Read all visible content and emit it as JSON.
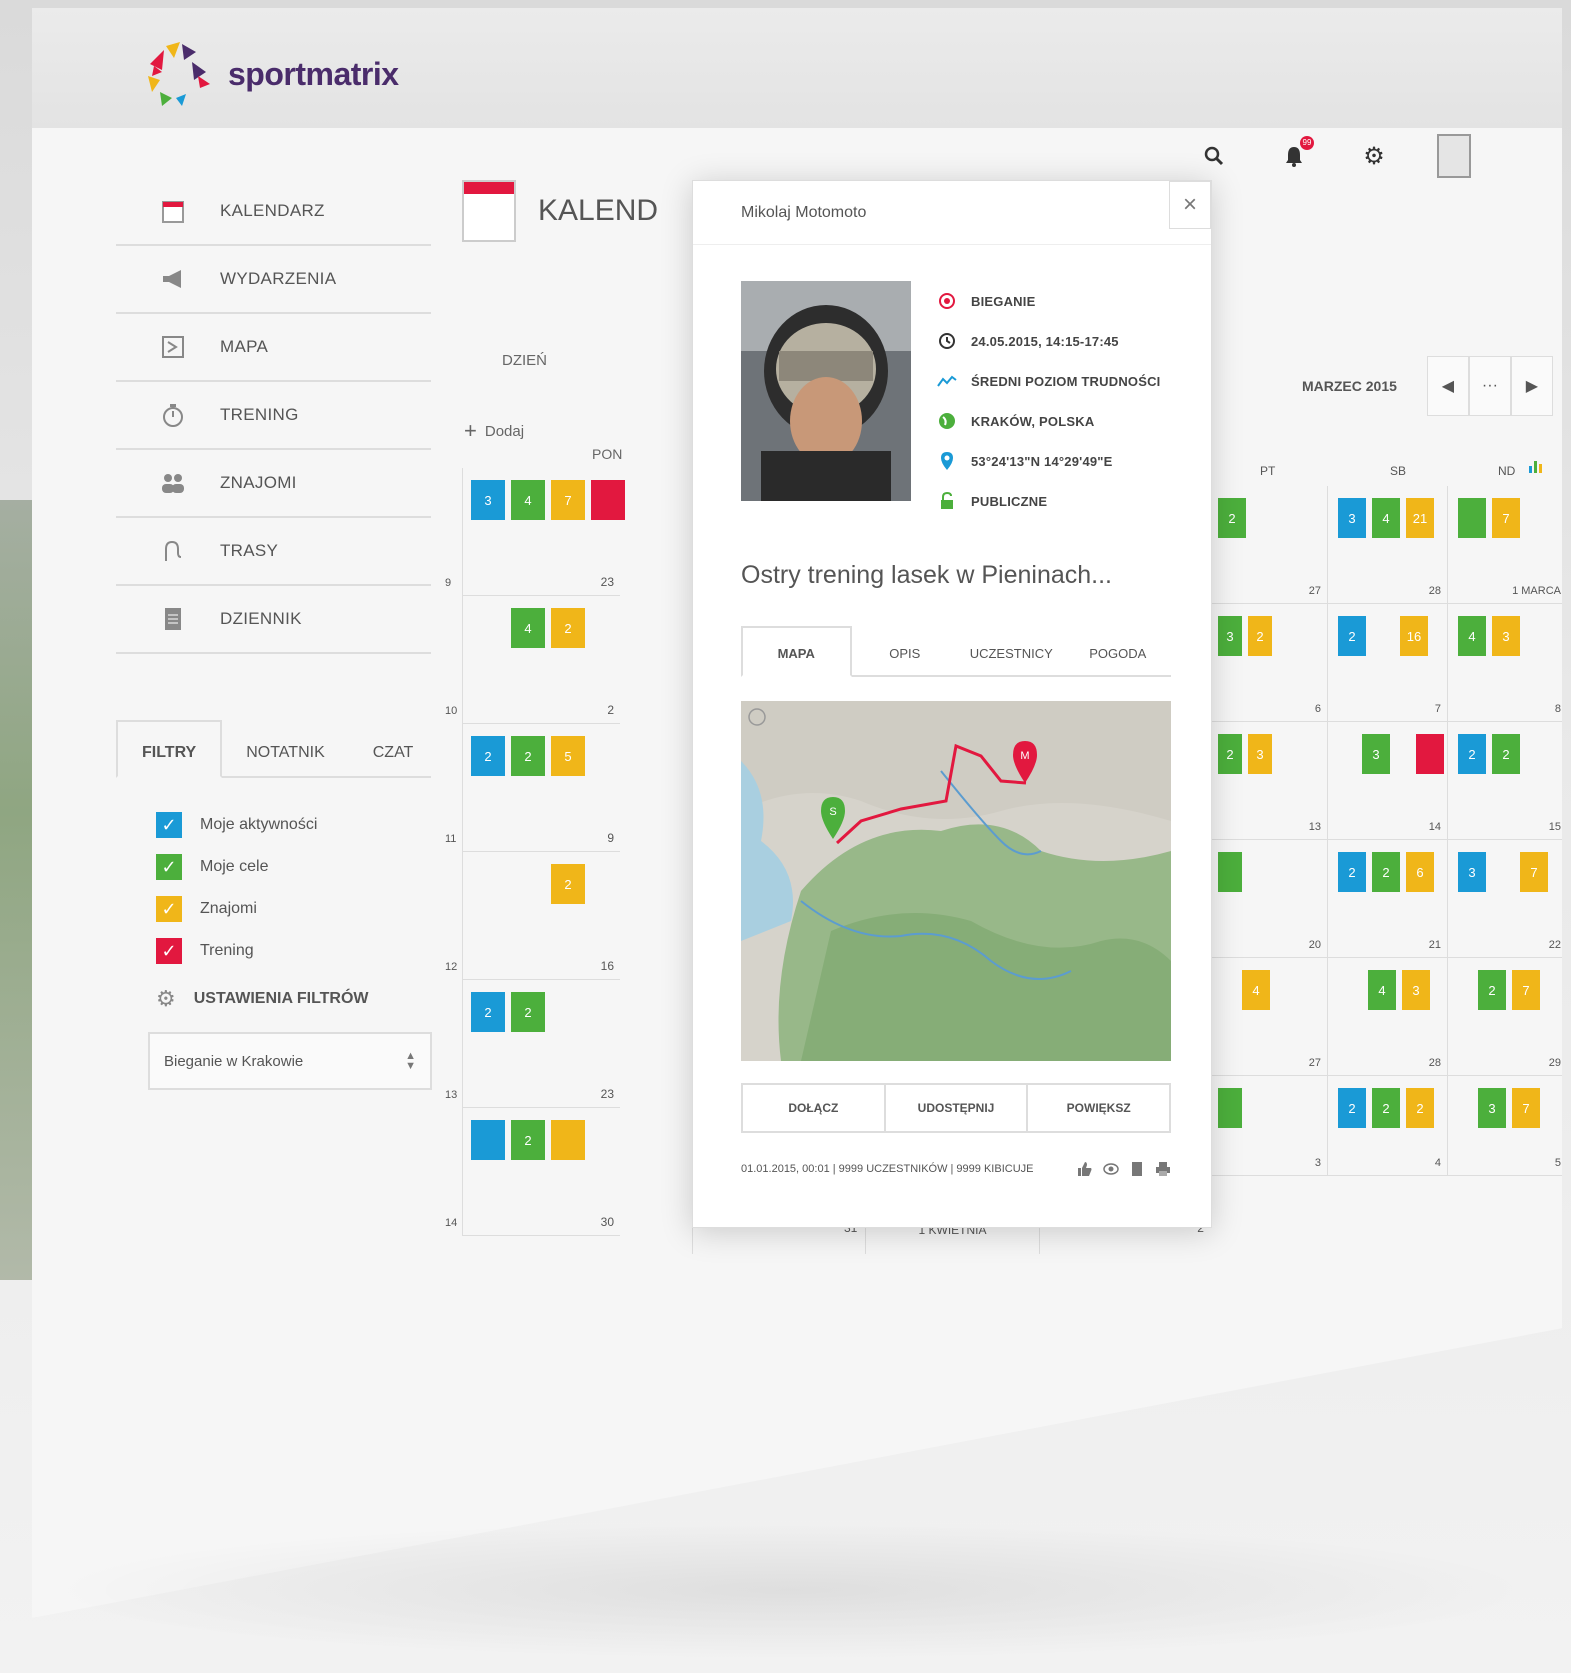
{
  "brand": {
    "name": "sportmatrix"
  },
  "topbar": {
    "notifications_count": "99"
  },
  "nav": {
    "items": [
      {
        "label": "KALENDARZ",
        "icon": "calendar-icon"
      },
      {
        "label": "WYDARZENIA",
        "icon": "megaphone-icon"
      },
      {
        "label": "MAPA",
        "icon": "map-icon"
      },
      {
        "label": "TRENING",
        "icon": "stopwatch-icon"
      },
      {
        "label": "ZNAJOMI",
        "icon": "friends-icon"
      },
      {
        "label": "TRASY",
        "icon": "route-icon"
      },
      {
        "label": "DZIENNIK",
        "icon": "journal-icon"
      }
    ]
  },
  "side_tabs": {
    "filters": "FILTRY",
    "notes": "NOTATNIK",
    "chat": "CZAT"
  },
  "filters": {
    "items": [
      {
        "label": "Moje aktywności",
        "color": "#1a9ad6"
      },
      {
        "label": "Moje cele",
        "color": "#4caf3c"
      },
      {
        "label": "Znajomi",
        "color": "#f0b619"
      },
      {
        "label": "Trening",
        "color": "#e2183f"
      }
    ],
    "settings_label": "USTAWIENIA FILTRÓW",
    "preset_value": "Bieganie w Krakowie"
  },
  "calendar": {
    "title": "KALEND",
    "view_day": "DZIEŃ",
    "add_label": "Dodaj",
    "col_mon": "PON",
    "month_label": "MARZEC 2015",
    "more": "···",
    "weekday_fri": "PT",
    "weekday_sat": "SB",
    "weekday_sun": "ND",
    "week_numbers": [
      "9",
      "10",
      "11",
      "12",
      "13",
      "14"
    ],
    "mon_days": [
      "23",
      "2",
      "9",
      "16",
      "23",
      "30"
    ],
    "bottom_row": {
      "a": "31",
      "b": "1 KWIETNIA",
      "c": "2",
      "d": "3",
      "e": "4",
      "f": "5"
    },
    "right_days": [
      [
        "27",
        "28",
        "1 MARCA"
      ],
      [
        "6",
        "7",
        "8"
      ],
      [
        "13",
        "14",
        "15"
      ],
      [
        "20",
        "21",
        "22"
      ],
      [
        "27",
        "28",
        "29"
      ]
    ],
    "chips": {
      "r1": [
        "3",
        "4",
        "7"
      ],
      "r2": [
        "4",
        "2"
      ],
      "r3": [
        "2",
        "2",
        "5"
      ],
      "r4": [
        "2"
      ],
      "r5": [
        "2",
        "2"
      ],
      "r6": [
        "2"
      ],
      "fri_chips": [
        [
          "3",
          "4",
          "21"
        ],
        [
          "2",
          "16"
        ],
        [
          "3"
        ],
        [
          "2",
          "2",
          "6"
        ],
        [
          "4",
          "3"
        ],
        [
          "2",
          "2",
          "2"
        ]
      ],
      "sat_chips": [
        [
          "7"
        ],
        [
          "4",
          "3"
        ],
        [
          "2",
          "2"
        ],
        [
          "3",
          "7"
        ],
        [
          "2",
          "7"
        ],
        [
          "3",
          "7"
        ]
      ],
      "thu_chips": [
        [
          "2"
        ],
        [
          "3",
          "2"
        ],
        [
          "2",
          "3"
        ],
        [
          ""
        ],
        [
          "4"
        ],
        [
          ""
        ]
      ]
    }
  },
  "modal": {
    "user": "Mikolaj Motomoto",
    "close": "×",
    "activity": "BIEGANIE",
    "datetime": "24.05.2015, 14:15-17:45",
    "difficulty": "ŚREDNI POZIOM TRUDNOŚCI",
    "location": "KRAKÓW, POLSKA",
    "coords": "53°24'13\"N 14°29'49\"E",
    "visibility": "PUBLICZNE",
    "headline": "Ostry trening lasek w Pieninach...",
    "tabs": [
      "MAPA",
      "OPIS",
      "UCZESTNICY",
      "POGODA"
    ],
    "map_start": "S",
    "map_end": "M",
    "actions": [
      "DOŁĄCZ",
      "UDOSTĘPNIJ",
      "POWIĘKSZ"
    ],
    "footer": "01.01.2015, 00:01 | 9999 UCZESTNIKÓW | 9999 KIBICUJE"
  },
  "colors": {
    "blue": "#1a9ad6",
    "green": "#4caf3c",
    "yellow": "#f0b619",
    "red": "#e2183f",
    "purple": "#4a2c6b"
  }
}
